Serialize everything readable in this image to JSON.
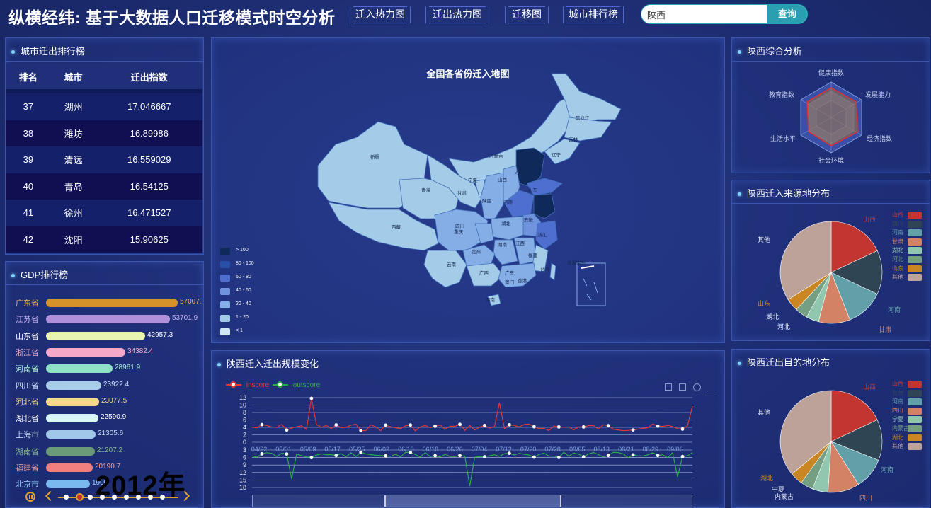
{
  "header": {
    "title": "纵横经纬: 基于大数据人口迁移模式时空分析",
    "tabs": [
      "迁入热力图",
      "迁出热力图",
      "迁移图",
      "城市排行榜"
    ],
    "search_value": "陕西",
    "search_button": "查询"
  },
  "rank_panel": {
    "title": "城市迁出排行榜",
    "columns": [
      "排名",
      "城市",
      "迁出指数"
    ],
    "rows": [
      [
        "37",
        "湖州",
        "17.046667"
      ],
      [
        "38",
        "潍坊",
        "16.89986"
      ],
      [
        "39",
        "清远",
        "16.559029"
      ],
      [
        "40",
        "青岛",
        "16.54125"
      ],
      [
        "41",
        "徐州",
        "16.471527"
      ],
      [
        "42",
        "沈阳",
        "15.90625"
      ]
    ]
  },
  "gdp_panel": {
    "title": "GDP排行榜",
    "year": "2012年",
    "items": [
      {
        "name": "广东省",
        "value": "57007.",
        "num": 57007,
        "color": "#d6922a",
        "label_color": "#f0b24a"
      },
      {
        "name": "江苏省",
        "value": "53701.9",
        "num": 53701.9,
        "color": "#b090d8",
        "label_color": "#c8b0f0"
      },
      {
        "name": "山东省",
        "value": "42957.3",
        "num": 42957.3,
        "color": "#e8f5b0",
        "label_color": "#ffffff"
      },
      {
        "name": "浙江省",
        "value": "34382.4",
        "num": 34382.4,
        "color": "#f5a8c8",
        "label_color": "#f5b0cf"
      },
      {
        "name": "河南省",
        "value": "28961.9",
        "num": 28961.9,
        "color": "#8ee0c8",
        "label_color": "#a8f0d8"
      },
      {
        "name": "四川省",
        "value": "23922.4",
        "num": 23922.4,
        "color": "#a8cde8",
        "label_color": "#c8e0f5"
      },
      {
        "name": "河北省",
        "value": "23077.5",
        "num": 23077.5,
        "color": "#f5d88a",
        "label_color": "#f5d88a"
      },
      {
        "name": "湖北省",
        "value": "22590.9",
        "num": 22590.9,
        "color": "#d8f5f8",
        "label_color": "#ffffff"
      },
      {
        "name": "上海市",
        "value": "21305.6",
        "num": 21305.6,
        "color": "#a0c8e8",
        "label_color": "#c0d8f0"
      },
      {
        "name": "湖南省",
        "value": "21207.2",
        "num": 21207.2,
        "color": "#6a9a78",
        "label_color": "#8ab898"
      },
      {
        "name": "福建省",
        "value": "20190.7",
        "num": 20190.7,
        "color": "#f08080",
        "label_color": "#f0a0a0"
      },
      {
        "name": "北京市",
        "value": "1900",
        "num": 19000,
        "color": "#7ab8f0",
        "label_color": "#a0d0ff"
      }
    ]
  },
  "map_panel": {
    "title": "全国各省份迁入地图",
    "legend": [
      {
        "label": "> 100",
        "color": "#0f2a5a"
      },
      {
        "label": "80 - 100",
        "color": "#2a4fa8"
      },
      {
        "label": "60 - 80",
        "color": "#4f6fd0"
      },
      {
        "label": "40 - 60",
        "color": "#6f93dc"
      },
      {
        "label": "20 - 40",
        "color": "#86aee6"
      },
      {
        "label": "1 - 20",
        "color": "#a4cbe8"
      },
      {
        "label": "< 1",
        "color": "#cfe6f5"
      }
    ],
    "province_labels": [
      "新疆",
      "西藏",
      "青海",
      "甘肃",
      "四川",
      "云南",
      "内蒙古",
      "宁夏",
      "陕西",
      "重庆",
      "贵州",
      "广西",
      "广东",
      "海南",
      "山西",
      "河北",
      "河南",
      "湖北",
      "湖南",
      "江西",
      "福建",
      "台湾",
      "浙江",
      "安徽",
      "江苏",
      "山东",
      "辽宁",
      "吉林",
      "黑龙江",
      "香港",
      "澳门",
      "南海诸岛"
    ]
  },
  "trend_panel": {
    "title": "陕西迁入迁出规模变化",
    "legend_in": "inscore",
    "legend_out": "outscore",
    "y_top_ticks": [
      "12",
      "10",
      "8",
      "6",
      "4",
      "2",
      "0"
    ],
    "y_bottom_ticks": [
      "3",
      "6",
      "9",
      "12",
      "15",
      "18"
    ],
    "x_ticks": [
      "04/22",
      "05/01",
      "05/09",
      "05/17",
      "05/25",
      "06/02",
      "06/10",
      "06/18",
      "06/26",
      "07/04",
      "07/12",
      "07/20",
      "07/28",
      "08/05",
      "08/13",
      "08/21",
      "08/29",
      "09/06"
    ],
    "in_color": "#e03a3a",
    "out_color": "#2faa4a"
  },
  "radar_panel": {
    "title": "陕西综合分析",
    "axes": [
      "健康指数",
      "发展能力",
      "经济指数",
      "社会环境",
      "生活水平",
      "教育指数"
    ]
  },
  "source_panel": {
    "title": "陕西迁入来源地分布",
    "labels": [
      "山西",
      "其他",
      "山东",
      "湖北",
      "河北",
      "河南",
      "甘肃"
    ],
    "legend_items": [
      "山西",
      "四川",
      "河南",
      "甘肃",
      "湖北",
      "河北",
      "山东",
      "其他"
    ]
  },
  "dest_panel": {
    "title": "陕西迁出目的地分布",
    "labels": [
      "山西",
      "其他",
      "湖北",
      "宁夏",
      "内蒙古",
      "四川",
      "河南"
    ],
    "legend_items": [
      "山西",
      "甘肃",
      "河南",
      "四川",
      "宁夏",
      "内蒙古",
      "湖北",
      "其他"
    ]
  }
}
